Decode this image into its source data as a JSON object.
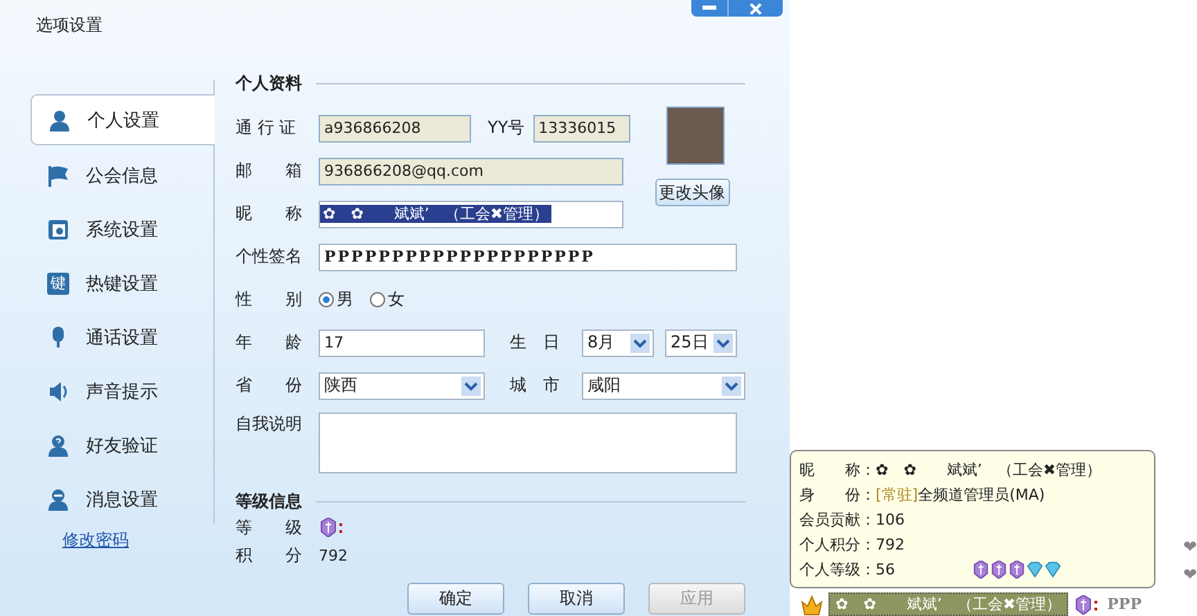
{
  "window": {
    "title": "选项设置"
  },
  "sidebar": {
    "items": [
      {
        "label": "个人设置",
        "kind": "person",
        "selected": true
      },
      {
        "label": "公会信息",
        "kind": "flag",
        "selected": false
      },
      {
        "label": "系统设置",
        "kind": "system",
        "selected": false
      },
      {
        "label": "热键设置",
        "kind": "key",
        "selected": false
      },
      {
        "label": "通话设置",
        "kind": "mic",
        "selected": false
      },
      {
        "label": "声音提示",
        "kind": "speaker",
        "selected": false
      },
      {
        "label": "好友验证",
        "kind": "question",
        "selected": false
      },
      {
        "label": "消息设置",
        "kind": "message",
        "selected": false
      }
    ],
    "key_glyph": "键",
    "link": "修改密码"
  },
  "profile": {
    "heading": "个人资料",
    "passport": {
      "label": "通 行 证",
      "value": "a936866208",
      "readonly": true
    },
    "yy": {
      "label": "YY号",
      "value": "13336015",
      "readonly": true
    },
    "email": {
      "label": "邮　　箱",
      "value": "936866208@qq.com",
      "readonly": true
    },
    "nickname": {
      "label": "昵　　称",
      "value": "✿　✿　　斌斌’　（工会✖管理）",
      "highlighted": true
    },
    "change_avatar": "更改头像",
    "signature": {
      "label": "个性签名",
      "value": "PPPPPPPPPPPPPPPPPPPP"
    },
    "gender": {
      "label": "性　　别",
      "options": [
        {
          "label": "男",
          "selected": true
        },
        {
          "label": "女",
          "selected": false
        }
      ]
    },
    "age": {
      "label": "年　　龄",
      "value": "17"
    },
    "birthday": {
      "label": "生　日",
      "month": "8月",
      "day": "25日"
    },
    "province": {
      "label": "省　　份",
      "value": "陕西"
    },
    "city": {
      "label": "城　市",
      "value": "咸阳"
    },
    "about": {
      "label": "自我说明"
    }
  },
  "level_info": {
    "heading": "等级信息",
    "level_label": "等　　级",
    "points_label": "积　　分",
    "points": "792"
  },
  "buttons": [
    {
      "label": "确定",
      "disabled": false
    },
    {
      "label": "取消",
      "disabled": false
    },
    {
      "label": "应用",
      "disabled": true
    }
  ],
  "tooltip": {
    "rows": [
      {
        "label": "昵　　称：",
        "value": "✿　✿　　斌斌’　（工会✖管理）"
      },
      {
        "label": "身　　份：",
        "tag": "[常驻]",
        "value": "全频道管理员(MA)"
      },
      {
        "label": "会员贡献：",
        "value": "106"
      },
      {
        "label": "个人积分：",
        "value": "792"
      },
      {
        "label": "个人等级：",
        "value": "56"
      }
    ],
    "badges": [
      {
        "kind": "shield"
      },
      {
        "kind": "shield"
      },
      {
        "kind": "shield"
      },
      {
        "kind": "diamond"
      },
      {
        "kind": "diamond"
      }
    ]
  },
  "chat_user": {
    "nickname": "✿　✿　　斌斌’　（工会✖管理）",
    "message": "PPP"
  },
  "side_fragments": [
    "❤",
    "❤"
  ]
}
